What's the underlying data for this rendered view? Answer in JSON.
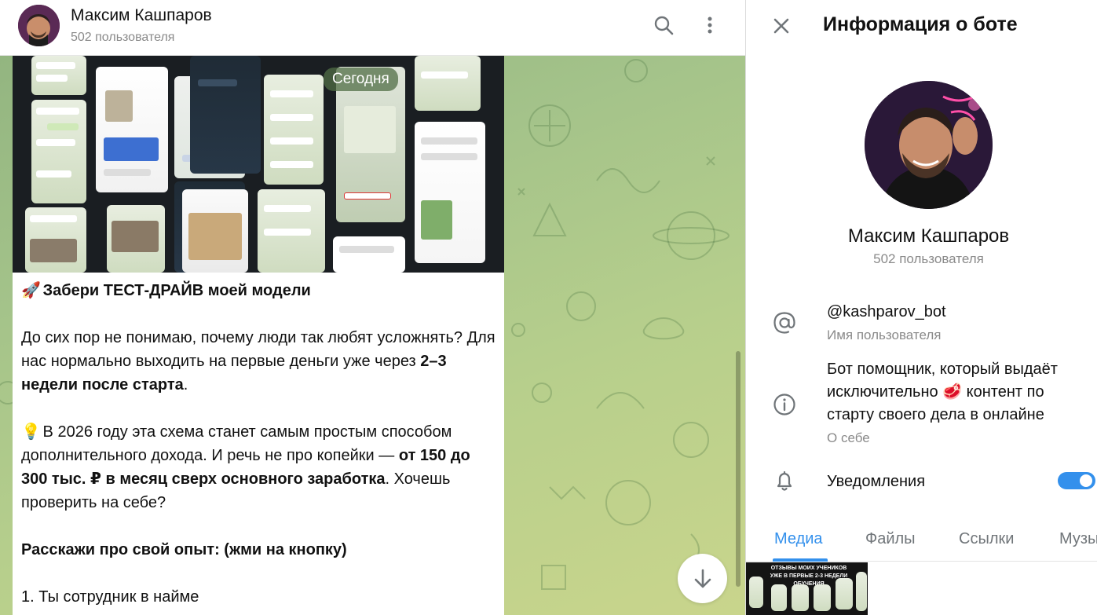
{
  "chat": {
    "title": "Максим Кашпаров",
    "subtitle": "502 пользователя",
    "date_pill": "Сегодня",
    "message": {
      "heading_emoji": "🚀",
      "heading": "Забери ТЕСТ-ДРАЙВ моей модели",
      "p1_a": "До сих пор не понимаю, почему люди так любят усложнять? Для нас нормально выходить на первые деньги уже через ",
      "p1_b": "2–3 недели после старта",
      "p1_c": ".",
      "p2_emoji": "💡",
      "p2_a": " В 2026 году эта схема станет самым простым способом дополнительного дохода. И речь не про копейки — ",
      "p2_b": "от 150 до 300 тыс. ₽ в месяц сверх основного заработка",
      "p2_c": ". Хочешь проверить на себе?",
      "p3": "Расскажи про свой опыт: (жми на кнопку)",
      "p4": "1. Ты сотрудник в найме"
    }
  },
  "info": {
    "title": "Информация о боте",
    "name": "Максим Кашпаров",
    "subtitle": "502 пользователя",
    "username": "@kashparov_bot",
    "username_label": "Имя пользователя",
    "about_a": "Бот помощник, который выдаёт исключительно ",
    "about_emoji": "🥩",
    "about_b": " контент по старту своего дела в онлайне",
    "about_label": "О себе",
    "notifications_label": "Уведомления",
    "notifications_on": true,
    "tabs": [
      "Медиа",
      "Файлы",
      "Ссылки",
      "Музыка"
    ],
    "active_tab": "Медиа",
    "media_caption": "ОТЗЫВЫ МОИХ УЧЕНИКОВ УЖЕ В ПЕРВЫЕ 2-3 НЕДЕЛИ ОБУЧЕНИЯ"
  },
  "colors": {
    "accent": "#3390ec",
    "chat_bg": "#a4c38a",
    "muted_text": "#8a8a8a"
  }
}
